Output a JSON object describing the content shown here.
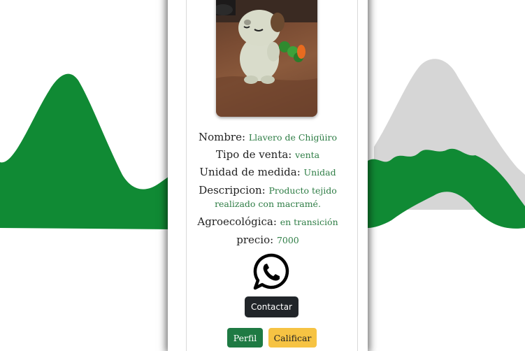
{
  "product": {
    "photo_icon": "amigurumi-keychain-photo",
    "fields": [
      {
        "label": "Nombre:",
        "value": "Llavero de Chigüiro"
      },
      {
        "label": "Tipo de venta:",
        "value": "venta"
      },
      {
        "label": "Unidad de medida:",
        "value": "Unidad"
      },
      {
        "label": "Descripcion:",
        "value_line1": "Producto tejido",
        "value_line2": "realizado con macramé."
      },
      {
        "label": "Agroecológica:",
        "value": "en transición"
      },
      {
        "label": "precio:",
        "value": "7000"
      }
    ]
  },
  "actions": {
    "whatsapp_icon": "whatsapp-icon",
    "contact_label": "Contactar",
    "profile_label": "Perfil",
    "rate_label": "Calificar"
  },
  "colors": {
    "mountain_green": "#108a34",
    "snow": "#d6d6d6",
    "value_green": "#2e7d45",
    "dark_button": "#212529",
    "perfil_button": "#1e7a43",
    "rate_button": "#f6c343"
  }
}
